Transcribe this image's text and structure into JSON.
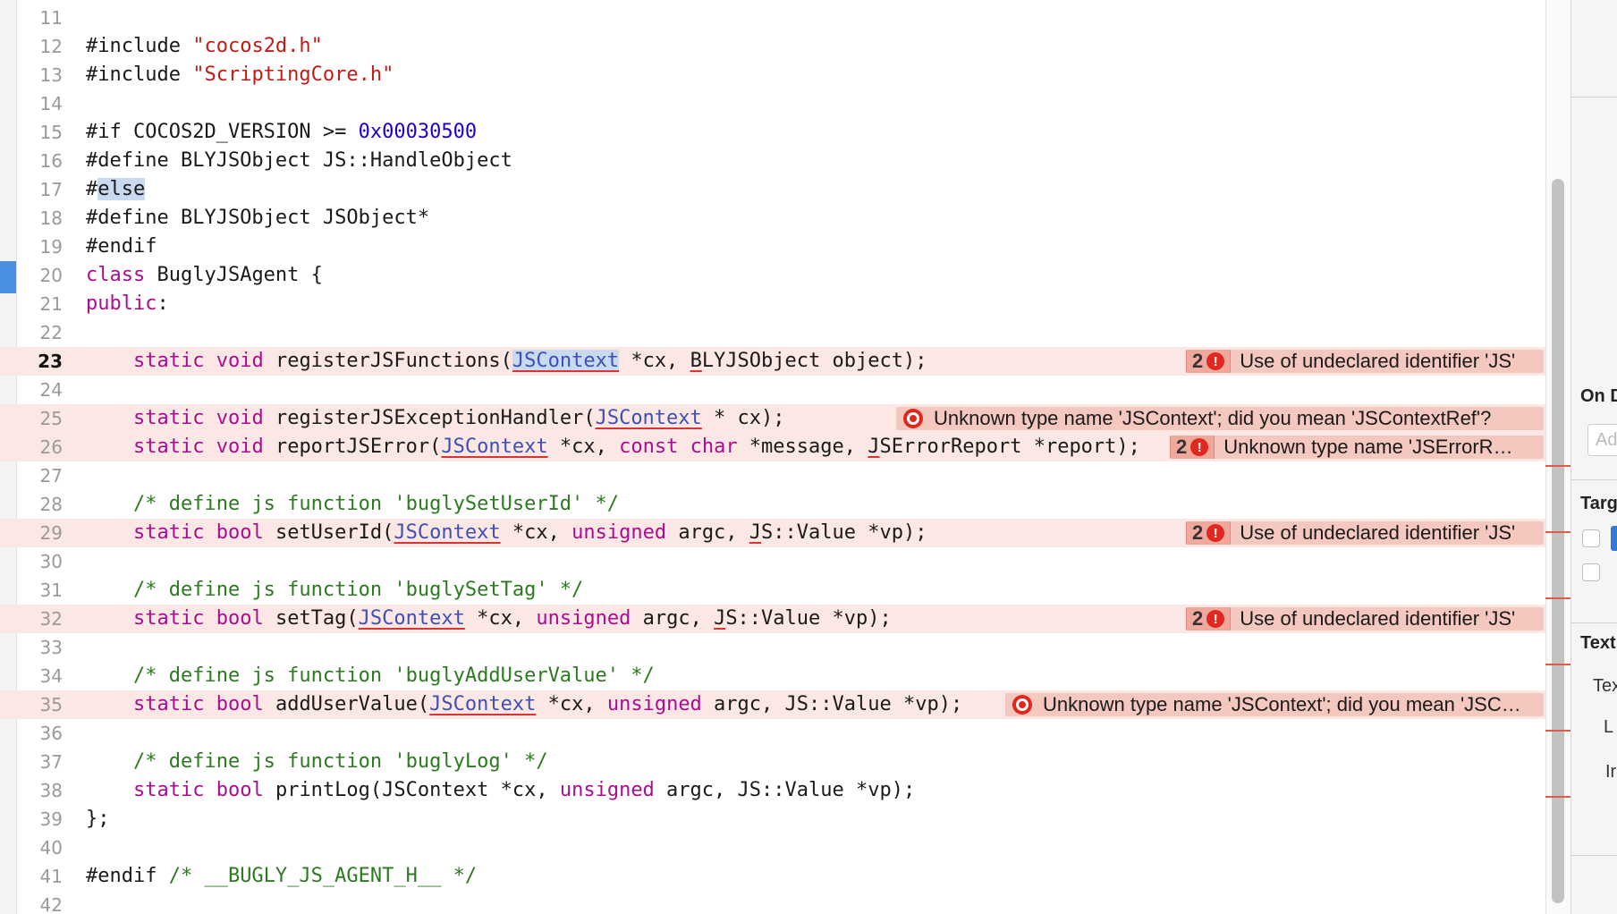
{
  "editor": {
    "lines": [
      {
        "n": "11",
        "tokens": []
      },
      {
        "n": "12",
        "tokens": [
          {
            "t": "#include "
          },
          {
            "t": "\"cocos2d.h\"",
            "c": "str"
          }
        ]
      },
      {
        "n": "13",
        "tokens": [
          {
            "t": "#include "
          },
          {
            "t": "\"ScriptingCore.h\"",
            "c": "str"
          }
        ]
      },
      {
        "n": "14",
        "tokens": []
      },
      {
        "n": "15",
        "tokens": [
          {
            "t": "#if COCOS2D_VERSION >= "
          },
          {
            "t": "0x00030500",
            "c": "num"
          }
        ]
      },
      {
        "n": "16",
        "tokens": [
          {
            "t": "#define BLYJSObject JS::HandleObject"
          }
        ]
      },
      {
        "n": "17",
        "tokens": [
          {
            "t": "#"
          },
          {
            "t": "else",
            "c": "hl"
          }
        ]
      },
      {
        "n": "18",
        "tokens": [
          {
            "t": "#define BLYJSObject JSObject*"
          }
        ]
      },
      {
        "n": "19",
        "tokens": [
          {
            "t": "#endif"
          }
        ]
      },
      {
        "n": "20",
        "tokens": [
          {
            "t": "class",
            "c": "kw"
          },
          {
            "t": " BuglyJSAgent {"
          }
        ]
      },
      {
        "n": "21",
        "tokens": [
          {
            "t": "public",
            "c": "kw"
          },
          {
            "t": ":"
          }
        ]
      },
      {
        "n": "22",
        "tokens": []
      },
      {
        "n": "23",
        "current": true,
        "error": true,
        "tokens": [
          {
            "t": "    "
          },
          {
            "t": "static",
            "c": "kw"
          },
          {
            "t": " "
          },
          {
            "t": "void",
            "c": "kw"
          },
          {
            "t": " registerJSFunctions("
          },
          {
            "t": "JSContext",
            "c": "link ul hl"
          },
          {
            "t": " *cx, "
          },
          {
            "t": "B",
            "c": "ul"
          },
          {
            "t": "LYJSObject object);"
          }
        ],
        "issue": {
          "count": "2",
          "message": "Use of undeclared identifier 'JS'"
        }
      },
      {
        "n": "24",
        "tokens": []
      },
      {
        "n": "25",
        "error": true,
        "tokens": [
          {
            "t": "    "
          },
          {
            "t": "static",
            "c": "kw"
          },
          {
            "t": " "
          },
          {
            "t": "void",
            "c": "kw"
          },
          {
            "t": " registerJSExceptionHandler("
          },
          {
            "t": "JSContext",
            "c": "link ul"
          },
          {
            "t": " * cx);"
          }
        ],
        "issue": {
          "message": "Unknown type name 'JSContext'; did you mean 'JSContextRef'?"
        }
      },
      {
        "n": "26",
        "error": true,
        "tokens": [
          {
            "t": "    "
          },
          {
            "t": "static",
            "c": "kw"
          },
          {
            "t": " "
          },
          {
            "t": "void",
            "c": "kw"
          },
          {
            "t": " reportJSError("
          },
          {
            "t": "JSContext",
            "c": "link ul"
          },
          {
            "t": " *cx, "
          },
          {
            "t": "const",
            "c": "kw"
          },
          {
            "t": " "
          },
          {
            "t": "char",
            "c": "kw"
          },
          {
            "t": " *message, "
          },
          {
            "t": "J",
            "c": "ul"
          },
          {
            "t": "SErrorReport *report);"
          }
        ],
        "issue": {
          "count": "2",
          "message": "Unknown type name 'JSErrorR…"
        }
      },
      {
        "n": "27",
        "tokens": []
      },
      {
        "n": "28",
        "tokens": [
          {
            "t": "    "
          },
          {
            "t": "/* define js function 'buglySetUserId' */",
            "c": "com"
          }
        ]
      },
      {
        "n": "29",
        "error": true,
        "tokens": [
          {
            "t": "    "
          },
          {
            "t": "static",
            "c": "kw"
          },
          {
            "t": " "
          },
          {
            "t": "bool",
            "c": "kw"
          },
          {
            "t": " setUserId("
          },
          {
            "t": "JSContext",
            "c": "link ul"
          },
          {
            "t": " *cx, "
          },
          {
            "t": "unsigned",
            "c": "kw"
          },
          {
            "t": " argc, "
          },
          {
            "t": "J",
            "c": "ul"
          },
          {
            "t": "S::Value *vp);"
          }
        ],
        "issue": {
          "count": "2",
          "message": "Use of undeclared identifier 'JS'"
        }
      },
      {
        "n": "30",
        "tokens": []
      },
      {
        "n": "31",
        "tokens": [
          {
            "t": "    "
          },
          {
            "t": "/* define js function 'buglySetTag' */",
            "c": "com"
          }
        ]
      },
      {
        "n": "32",
        "error": true,
        "tokens": [
          {
            "t": "    "
          },
          {
            "t": "static",
            "c": "kw"
          },
          {
            "t": " "
          },
          {
            "t": "bool",
            "c": "kw"
          },
          {
            "t": " setTag("
          },
          {
            "t": "JSContext",
            "c": "link ul"
          },
          {
            "t": " *cx, "
          },
          {
            "t": "unsigned",
            "c": "kw"
          },
          {
            "t": " argc, "
          },
          {
            "t": "J",
            "c": "ul"
          },
          {
            "t": "S::Value *vp);"
          }
        ],
        "issue": {
          "count": "2",
          "message": "Use of undeclared identifier 'JS'"
        }
      },
      {
        "n": "33",
        "tokens": []
      },
      {
        "n": "34",
        "tokens": [
          {
            "t": "    "
          },
          {
            "t": "/* define js function 'buglyAddUserValue' */",
            "c": "com"
          }
        ]
      },
      {
        "n": "35",
        "error": true,
        "tokens": [
          {
            "t": "    "
          },
          {
            "t": "static",
            "c": "kw"
          },
          {
            "t": " "
          },
          {
            "t": "bool",
            "c": "kw"
          },
          {
            "t": " addUserValue("
          },
          {
            "t": "JSContext",
            "c": "link ul"
          },
          {
            "t": " *cx, "
          },
          {
            "t": "unsigned",
            "c": "kw"
          },
          {
            "t": " argc, JS::Value *vp);"
          }
        ],
        "issue": {
          "message": "Unknown type name 'JSContext'; did you mean 'JSC…"
        }
      },
      {
        "n": "36",
        "tokens": []
      },
      {
        "n": "37",
        "tokens": [
          {
            "t": "    "
          },
          {
            "t": "/* define js function 'buglyLog' */",
            "c": "com"
          }
        ]
      },
      {
        "n": "38",
        "tokens": [
          {
            "t": "    "
          },
          {
            "t": "static",
            "c": "kw"
          },
          {
            "t": " "
          },
          {
            "t": "bool",
            "c": "kw"
          },
          {
            "t": " printLog(JSContext *cx, "
          },
          {
            "t": "unsigned",
            "c": "kw"
          },
          {
            "t": " argc, JS::Value *vp);"
          }
        ]
      },
      {
        "n": "39",
        "tokens": [
          {
            "t": "};"
          }
        ]
      },
      {
        "n": "40",
        "tokens": []
      },
      {
        "n": "41",
        "tokens": [
          {
            "t": "#endif "
          },
          {
            "t": "/* __BUGLY_JS_AGENT_H__ */",
            "c": "com"
          }
        ]
      },
      {
        "n": "42",
        "tokens": []
      }
    ]
  },
  "inspector": {
    "on_demand_label": "On D",
    "add_placeholder": "Ad",
    "target_label": "Targ",
    "text_label": "Text",
    "text_field_label": "Tex",
    "line_label": "L",
    "indent_label": "Ir"
  },
  "colors": {
    "keyword": "#aa0d91",
    "string": "#c41a16",
    "number": "#1c00cf",
    "comment": "#2c7a1f",
    "error_line": "#fbe7e4",
    "error_badge": "#e0281e"
  }
}
